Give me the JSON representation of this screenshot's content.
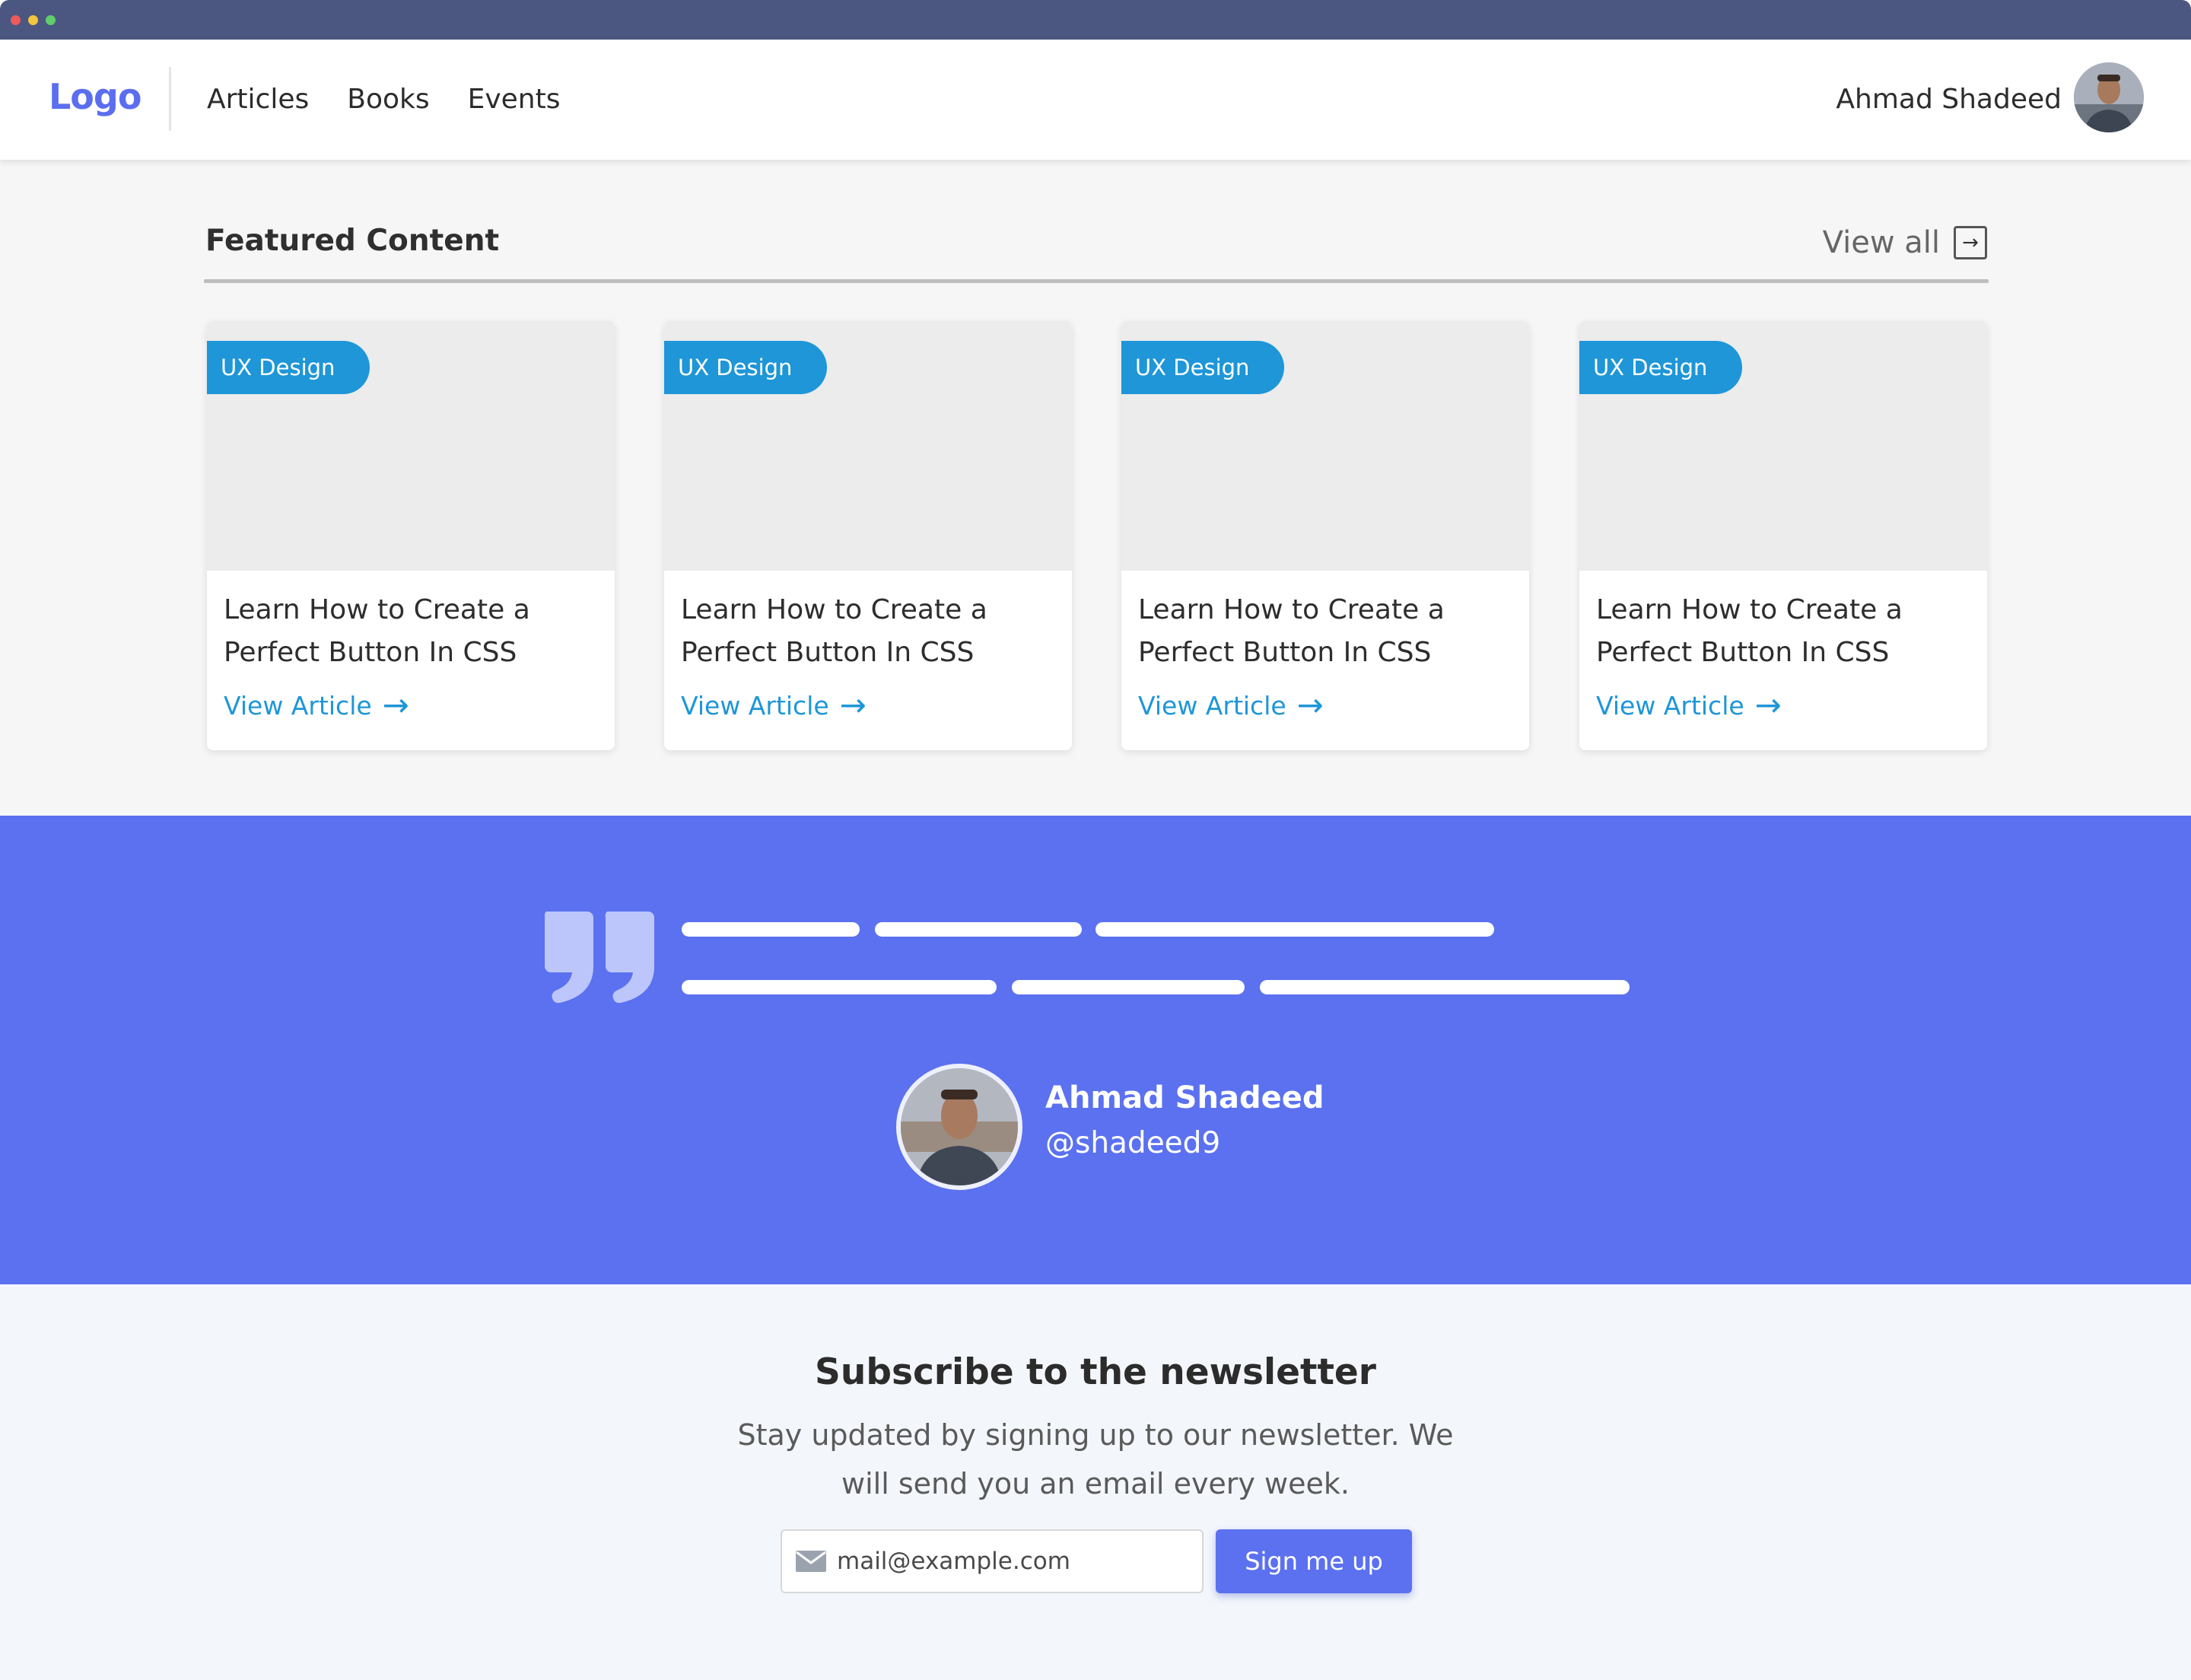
{
  "header": {
    "logo": "Logo",
    "nav": [
      "Articles",
      "Books",
      "Events"
    ],
    "user_name": "Ahmad Shadeed"
  },
  "featured": {
    "title": "Featured Content",
    "view_all": "View all",
    "cards": [
      {
        "badge": "UX Design",
        "title": "Learn How to Create a Perfect Button In CSS",
        "link": "View Article"
      },
      {
        "badge": "UX Design",
        "title": "Learn How to Create a Perfect Button In CSS",
        "link": "View Article"
      },
      {
        "badge": "UX Design",
        "title": "Learn How to Create a Perfect Button In CSS",
        "link": "View Article"
      },
      {
        "badge": "UX Design",
        "title": "Learn How to Create a Perfect Button In CSS",
        "link": "View Article"
      }
    ]
  },
  "testimonial": {
    "author_name": "Ahmad Shadeed",
    "author_handle": "@shadeed9"
  },
  "newsletter": {
    "title": "Subscribe to the newsletter",
    "description": "Stay updated by signing up to our newsletter. We will send you an email every week.",
    "email_placeholder": "mail@example.com",
    "button_label": "Sign me up"
  },
  "colors": {
    "brand": "#5b71f0",
    "accent": "#1e96d8",
    "titlebar": "#4b5781"
  }
}
